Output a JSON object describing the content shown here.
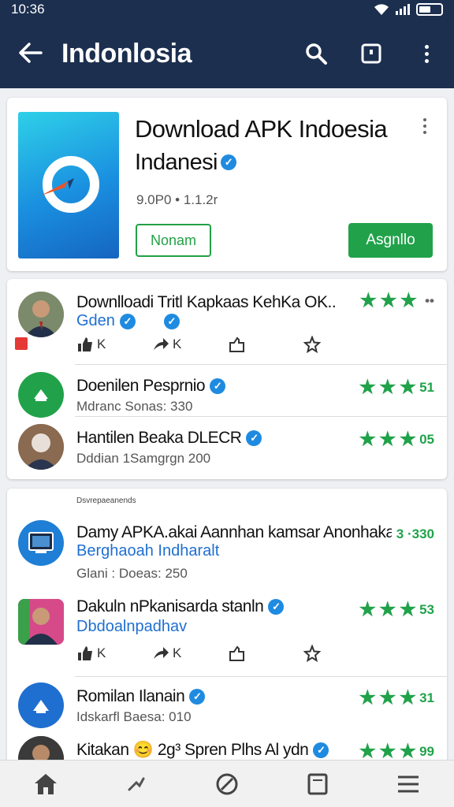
{
  "status": {
    "time": "10:36"
  },
  "appbar": {
    "title": "Indonlosia"
  },
  "hero": {
    "title": "Download APK Indoesia",
    "subtitle": "Indanesi",
    "meta": "9.0P0 • 1.1.2r",
    "outline_btn": "Nonam",
    "primary_btn": "Asgnllo"
  },
  "list1": [
    {
      "name": "Downlloadi Tritl Kapkaas KehKa OK..",
      "link": "Gden",
      "rating": "••",
      "actions": [
        "K",
        "K",
        "",
        ""
      ]
    },
    {
      "name": "Doenilen Pesprnio",
      "sub": "Mdranc Sonas: 330",
      "rating": "51"
    },
    {
      "name": "Hantilen Beaka DLECR",
      "sub": "Dddian 1Samgrgn 200",
      "rating": "05"
    }
  ],
  "list2": {
    "section_label": "Dsvrepaeanends",
    "rows": [
      {
        "name": "Damy APKA.akai Aannhan kamsar Anonhakar",
        "link": "Berghaoah Indharalt",
        "sub": "Glani : Doeas: 250",
        "rating": "3 ·330"
      },
      {
        "name": "Dakuln nPkanisarda stanln",
        "link": "Dbdoalnpadhav",
        "rating": "53",
        "actions": [
          "K",
          "K",
          "",
          ""
        ]
      },
      {
        "name": "Romilan Ilanain",
        "sub": "Idskarfl Baesa: 010",
        "rating": "31"
      },
      {
        "name": "Kitakan 😊 2g³ Spren Plhs Al ydn",
        "rating": "99"
      }
    ]
  },
  "colors": {
    "brand": "#1c2f4f",
    "accent": "#21a24a",
    "link": "#1f6fd0",
    "verified": "#1f8be0"
  },
  "icons": [
    "back-arrow-icon",
    "search-icon",
    "window-icon",
    "more-vert-icon",
    "verified-icon",
    "star-icon",
    "like-icon",
    "share-icon",
    "reply-icon",
    "bookmark-icon",
    "home-icon",
    "discover-icon",
    "explore-icon",
    "library-icon",
    "menu-icon"
  ]
}
